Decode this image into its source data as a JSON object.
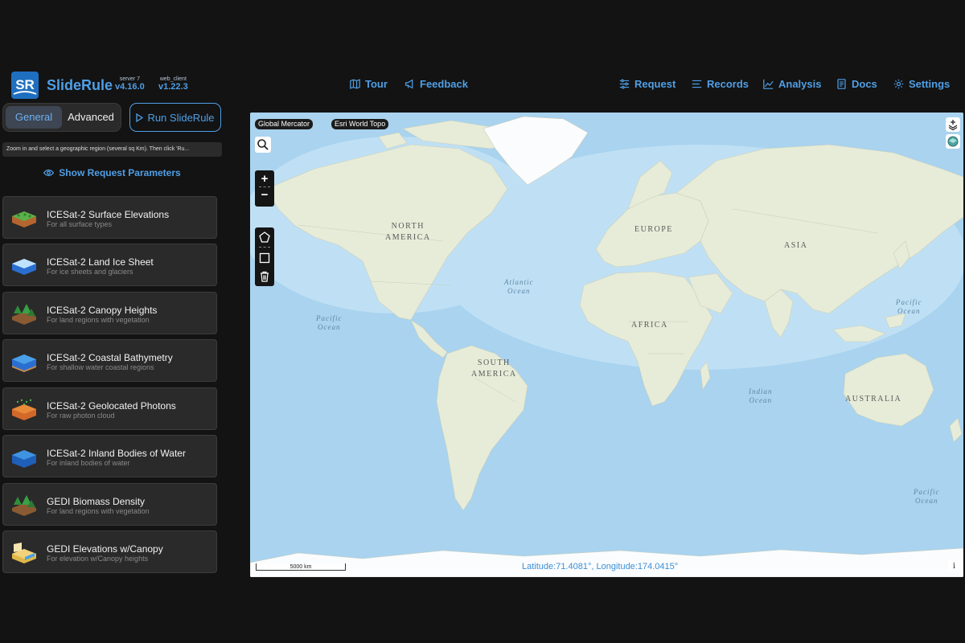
{
  "header": {
    "app_name": "SlideRule",
    "server_label": "server 7",
    "server_version": "v4.16.0",
    "client_label": "web_client",
    "client_version": "v1.22.3",
    "logo_text": "SR",
    "nav": {
      "tour": "Tour",
      "feedback": "Feedback",
      "request": "Request",
      "records": "Records",
      "analysis": "Analysis",
      "docs": "Docs",
      "settings": "Settings"
    }
  },
  "panel": {
    "tab_general": "General",
    "tab_advanced": "Advanced",
    "active_tab": "General",
    "run_button": "Run SlideRule",
    "hint": "Zoom in and select a geographic region (several sq Km). Then click 'Ru...",
    "show_params": "Show Request Parameters",
    "cards": [
      {
        "title": "ICESat-2 Surface Elevations",
        "subtitle": "For all surface types"
      },
      {
        "title": "ICESat-2 Land Ice Sheet",
        "subtitle": "For ice sheets and glaciers"
      },
      {
        "title": "ICESat-2 Canopy Heights",
        "subtitle": "For land regions with vegetation"
      },
      {
        "title": "ICESat-2 Coastal Bathymetry",
        "subtitle": "For shallow water coastal regions"
      },
      {
        "title": "ICESat-2 Geolocated Photons",
        "subtitle": "For raw photon cloud"
      },
      {
        "title": "ICESat-2 Inland Bodies of Water",
        "subtitle": "For inland bodies of water"
      },
      {
        "title": "GEDI Biomass Density",
        "subtitle": "For land regions with vegetation"
      },
      {
        "title": "GEDI Elevations w/Canopy",
        "subtitle": "For elevation w/Canopy heights"
      }
    ]
  },
  "map": {
    "projection": "Global Mercator",
    "basemap": "Esri World Topo",
    "scale": "5000 km",
    "coords": "Latitude:71.4081°, Longitude:174.0415°",
    "info": "i",
    "labels": {
      "north_america_1": "NORTH",
      "north_america_2": "AMERICA",
      "south_america_1": "SOUTH",
      "south_america_2": "AMERICA",
      "europe": "EUROPE",
      "asia": "ASIA",
      "africa": "AFRICA",
      "australia": "AUSTRALIA",
      "atlantic_1": "Atlantic",
      "atlantic_2": "Ocean",
      "pacific_w_1": "Pacific",
      "pacific_w_2": "Ocean",
      "pacific_e_1": "Pacific",
      "pacific_e_2": "Ocean",
      "pacific_s_1": "Pacific",
      "pacific_s_2": "Ocean",
      "indian_1": "Indian",
      "indian_2": "Ocean"
    }
  },
  "colors": {
    "accent": "#4f9fe6",
    "background": "#131313",
    "card": "#2a2a2a",
    "ocean": "#a9d3ef",
    "land": "#e7ecd8"
  }
}
